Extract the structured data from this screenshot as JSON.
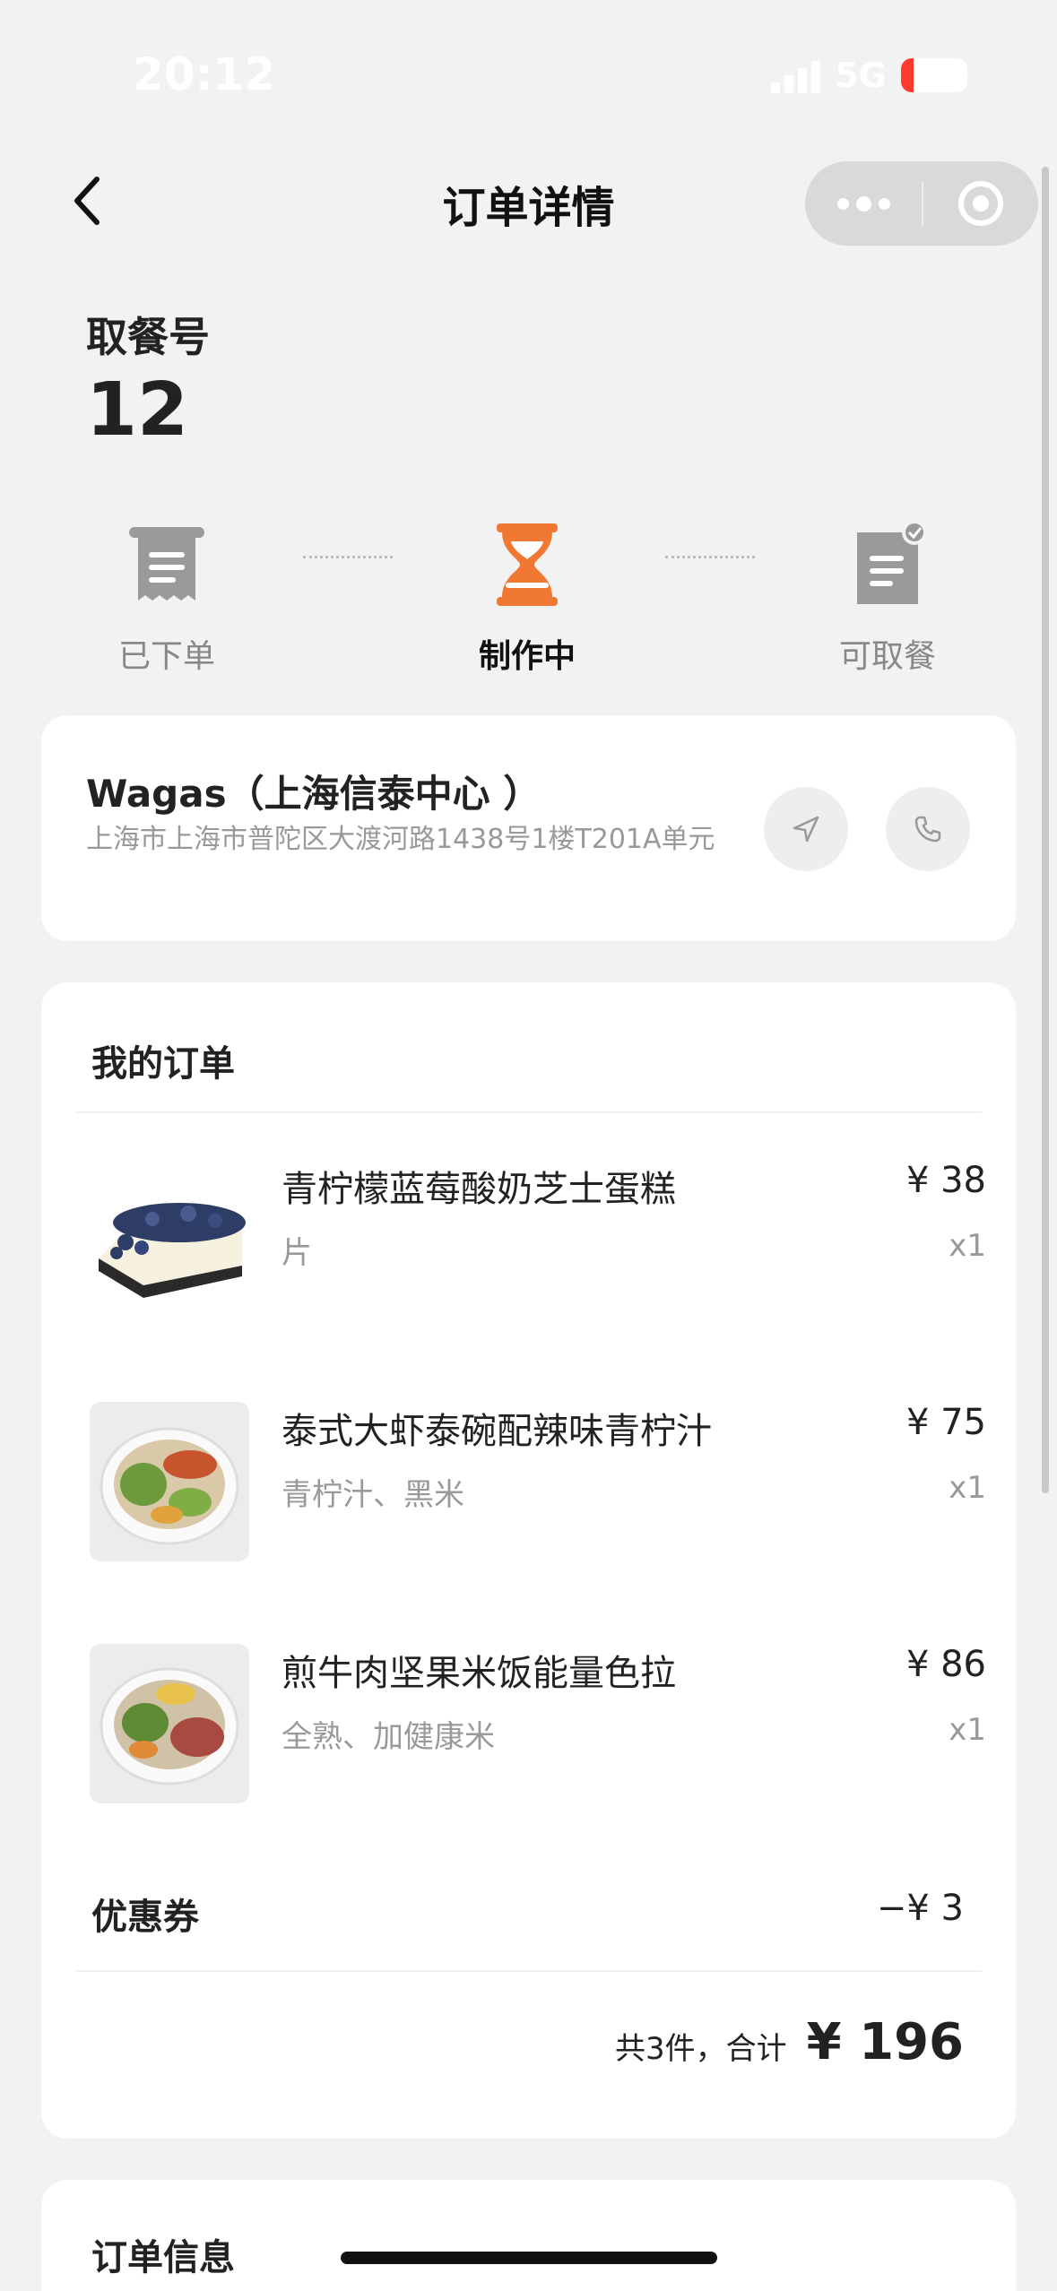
{
  "status_bar": {
    "time": "20:12",
    "network": "5G",
    "battery": "19"
  },
  "nav": {
    "title": "订单详情"
  },
  "pickup": {
    "label": "取餐号",
    "number": "12"
  },
  "progress": {
    "steps": [
      {
        "label": "已下单",
        "icon": "receipt-icon",
        "active": false
      },
      {
        "label": "制作中",
        "icon": "hourglass-icon",
        "active": true
      },
      {
        "label": "可取餐",
        "icon": "checked-document-icon",
        "active": false
      }
    ],
    "active_color": "#f07832",
    "inactive_color": "#999999"
  },
  "store": {
    "name": "Wagas（上海信泰中心 ）",
    "address": "上海市上海市普陀区大渡河路1438号1楼T201A单元"
  },
  "order": {
    "title": "我的订单",
    "items": [
      {
        "name": "青柠檬蓝莓酸奶芝士蛋糕",
        "spec": "片",
        "price": "¥ 38",
        "qty": "x1"
      },
      {
        "name": "泰式大虾泰碗配辣味青柠汁",
        "spec": "青柠汁、黑米",
        "price": "¥ 75",
        "qty": "x1"
      },
      {
        "name": "煎牛肉坚果米饭能量色拉",
        "spec": "全熟、加健康米",
        "price": "¥ 86",
        "qty": "x1"
      }
    ],
    "coupon_label": "优惠券",
    "coupon_value": "−¥ 3",
    "total_text": "共3件，合计",
    "total_value": "¥ 196"
  },
  "info": {
    "title": "订单信息"
  }
}
